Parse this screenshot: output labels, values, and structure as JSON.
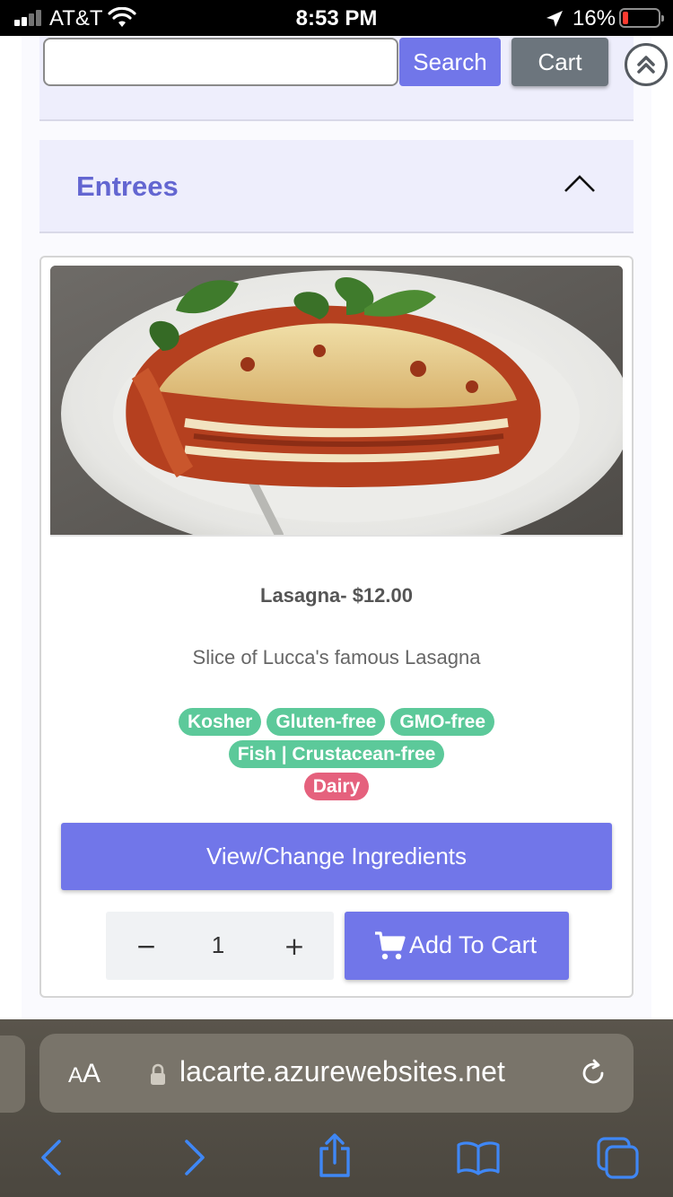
{
  "status_bar": {
    "carrier": "AT&T",
    "time": "8:53 PM",
    "battery_percent": "16%",
    "battery_level": 0.16
  },
  "header": {
    "search": {
      "value": "",
      "placeholder": ""
    },
    "search_label": "Search",
    "cart_label": "Cart"
  },
  "category": {
    "title": "Entrees",
    "expanded": true
  },
  "item": {
    "title": "Lasagna- $12.00",
    "description": "Slice of Lucca's famous Lasagna",
    "tags": [
      {
        "label": "Kosher",
        "color": "#5cc99a"
      },
      {
        "label": "Gluten-free",
        "color": "#5cc99a"
      },
      {
        "label": "GMO-free",
        "color": "#5cc99a"
      },
      {
        "label": "Fish | Crustacean-free",
        "color": "#5cc99a"
      },
      {
        "label": "Dairy",
        "color": "#e5617d"
      }
    ],
    "ingredients_button": "View/Change Ingredients",
    "quantity": "1",
    "minus_label": "−",
    "plus_label": "+",
    "add_to_cart_label": "Add To Cart"
  },
  "browser": {
    "text_size_small": "A",
    "text_size_big": "A",
    "url": "lacarte.azurewebsites.net"
  },
  "colors": {
    "accent": "#7176e9",
    "category_text": "#6366d1",
    "tag_green": "#5cc99a",
    "tag_red": "#e5617d",
    "ios_blue": "#3f87f5"
  },
  "icons": [
    "signal-icon",
    "wifi-icon",
    "location-icon",
    "battery-icon",
    "double-chevron-up-icon",
    "chevron-up-icon",
    "cart-icon",
    "lock-icon",
    "reload-icon",
    "back-icon",
    "forward-icon",
    "share-icon",
    "bookmarks-icon",
    "tabs-icon"
  ]
}
